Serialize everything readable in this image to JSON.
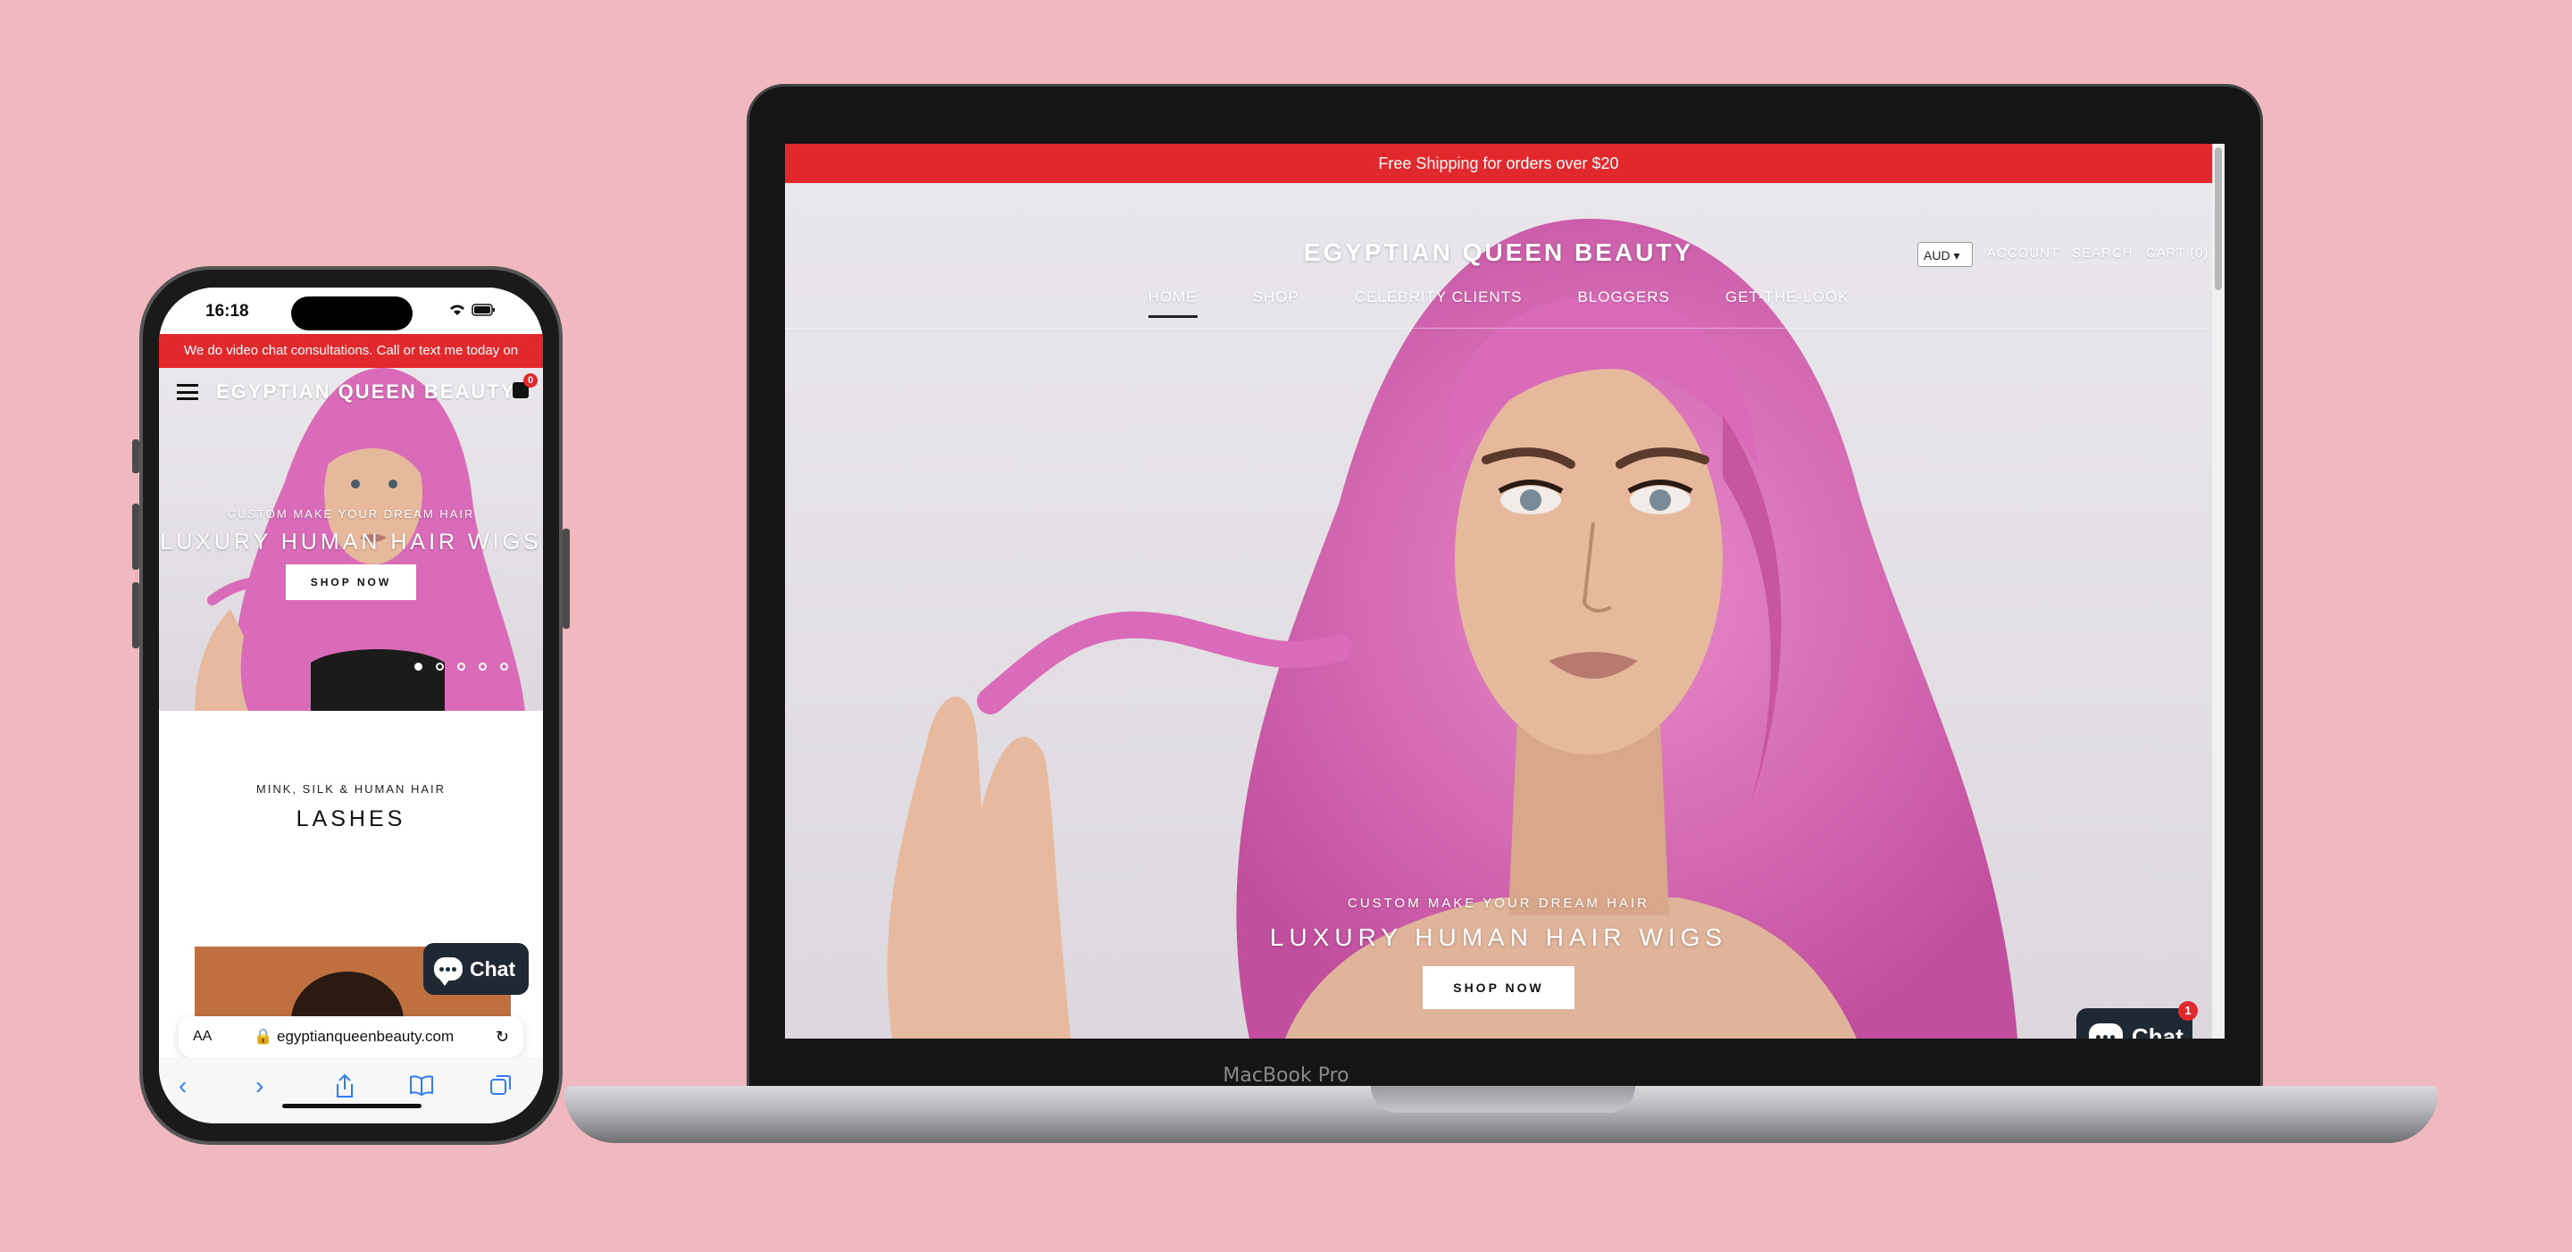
{
  "laptop": {
    "label": "MacBook Pro",
    "announcement": "Free Shipping for orders over $20",
    "logo": "EGYPTIAN QUEEN BEAUTY",
    "nav": [
      "HOME",
      "SHOP",
      "CELEBRITY CLIENTS",
      "BLOGGERS",
      "GET-THE-LOOK"
    ],
    "currency": "AUD",
    "tools": {
      "account": "ACCOUNT",
      "search": "SEARCH",
      "cart": "CART (0)"
    },
    "hero": {
      "subtitle": "CUSTOM MAKE YOUR DREAM HAIR",
      "title": "LUXURY HUMAN HAIR WIGS",
      "button": "SHOP NOW"
    },
    "chat": {
      "label": "Chat",
      "badge": "1"
    }
  },
  "phone": {
    "time": "16:18",
    "announcement": "We do video chat consultations. Call or text me today on",
    "logo": "EGYPTIAN QUEEN BEAUTY",
    "cart_count": "0",
    "hero": {
      "subtitle": "CUSTOM MAKE YOUR DREAM HAIR",
      "title": "LUXURY HUMAN HAIR WIGS",
      "button": "SHOP NOW"
    },
    "section": {
      "subtitle": "MINK, SILK & HUMAN HAIR",
      "title": "LASHES"
    },
    "chat": {
      "label": "Chat"
    },
    "browser": {
      "text_size": "AA",
      "url": "egyptianqueenbeauty.com"
    }
  },
  "colors": {
    "background": "#f0b8c0",
    "announcement": "#e1282d",
    "chat": "#1f2933",
    "hair": "#d96bb8"
  }
}
